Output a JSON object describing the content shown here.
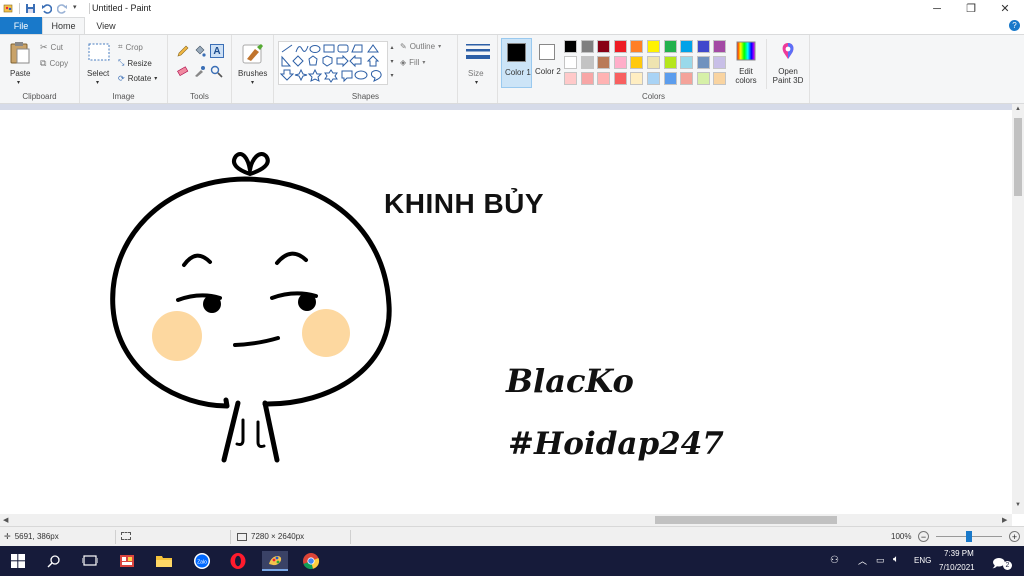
{
  "window": {
    "title": "Untitled - Paint",
    "minimize_glyph": "─",
    "maximize_glyph": "❐",
    "close_glyph": "✕"
  },
  "menu": {
    "file": "File",
    "home": "Home",
    "view": "View",
    "help_glyph": "?"
  },
  "ribbon": {
    "clipboard": {
      "label": "Clipboard",
      "paste": "Paste",
      "cut": "Cut",
      "copy": "Copy"
    },
    "image": {
      "label": "Image",
      "select": "Select",
      "crop": "Crop",
      "resize": "Resize",
      "rotate": "Rotate"
    },
    "tools": {
      "label": "Tools"
    },
    "brushes": {
      "label": "Brushes"
    },
    "shapes": {
      "label": "Shapes",
      "outline": "Outline",
      "fill": "Fill"
    },
    "size": {
      "label": "Size"
    },
    "colors": {
      "label": "Colors",
      "color1": "Color 1",
      "color2": "Color 2",
      "edit_colors": "Edit colors",
      "open_paint3d": "Open Paint 3D",
      "color1_value": "#000000",
      "color2_value": "#ffffff",
      "palette_row1": [
        "#000000",
        "#7f7f7f",
        "#880015",
        "#ed1c24",
        "#ff7f27",
        "#fff200",
        "#22b14c",
        "#00a2e8",
        "#3f48cc",
        "#a349a4"
      ],
      "palette_row2": [
        "#ffffff",
        "#c3c3c3",
        "#b97a57",
        "#ffaec9",
        "#ffc90e",
        "#efe4b0",
        "#b5e61d",
        "#99d9ea",
        "#7092be",
        "#c8bfe7"
      ],
      "palette_row3": [
        "#ffc9c9",
        "#f7a6a6",
        "#ffb3b3",
        "#f86060",
        "#ffeec2",
        "#a9d3f5",
        "#5c9ded",
        "#f4a39a",
        "#d6f0a8",
        "#f9d4a1"
      ]
    }
  },
  "canvas": {
    "heading": "KHINH BỦY",
    "signature_line1": "BlacKo",
    "signature_line2": "#Hoidap247",
    "drawing_colors": {
      "line": "#000000",
      "cheek": "#fdd8a0"
    }
  },
  "statusbar": {
    "cursor_position": "5691, 386px",
    "canvas_size": "7280 × 2640px",
    "zoom": "100%"
  },
  "taskbar": {
    "language": "ENG",
    "time": "7:39 PM",
    "date": "7/10/2021",
    "notification_count": "2"
  }
}
